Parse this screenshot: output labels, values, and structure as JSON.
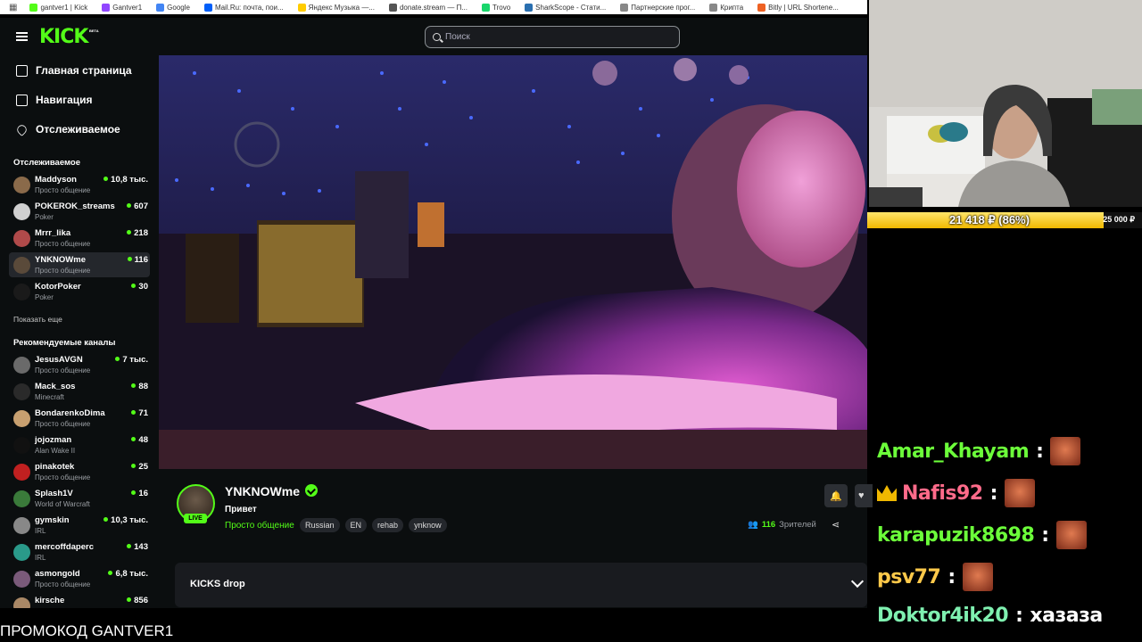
{
  "bookmarks": [
    {
      "label": "gantver1 | Kick",
      "color": "#53fc18"
    },
    {
      "label": "Gantver1",
      "color": "#9146ff"
    },
    {
      "label": "Google",
      "color": "#4285f4"
    },
    {
      "label": "Mail.Ru: почта, пои...",
      "color": "#005ff9"
    },
    {
      "label": "Яндекс Музыка —...",
      "color": "#ffcc00"
    },
    {
      "label": "donate.stream — П...",
      "color": "#555555"
    },
    {
      "label": "Trovo",
      "color": "#19d66b"
    },
    {
      "label": "SharkScope - Стати...",
      "color": "#2a6fb0"
    },
    {
      "label": "Партнерские прог...",
      "color": "#888888"
    },
    {
      "label": "Крипта",
      "color": "#888888"
    },
    {
      "label": "Bitly | URL Shortene...",
      "color": "#ee6123"
    }
  ],
  "header": {
    "logo": "KICK",
    "beta": "BETA",
    "search_placeholder": "Поиск"
  },
  "nav": [
    {
      "label": "Главная страница",
      "icon": "home-icon"
    },
    {
      "label": "Навигация",
      "icon": "browse-icon"
    },
    {
      "label": "Отслеживаемое",
      "icon": "heart-icon"
    }
  ],
  "following_title": "Отслеживаемое",
  "following": [
    {
      "name": "Maddyson",
      "category": "Просто общение",
      "viewers": "10,8 тыс.",
      "avatar": "#8a6a4a"
    },
    {
      "name": "POKEROK_streams",
      "category": "Poker",
      "viewers": "607",
      "avatar": "#d0d0d0"
    },
    {
      "name": "Mrrr_lika",
      "category": "Просто общение",
      "viewers": "218",
      "avatar": "#b04a4a"
    },
    {
      "name": "YNKNOWme",
      "category": "Просто общение",
      "viewers": "116",
      "avatar": "#5a4a3a"
    },
    {
      "name": "KotorPoker",
      "category": "Poker",
      "viewers": "30",
      "avatar": "#1a1a1a"
    }
  ],
  "show_more": "Показать еще",
  "recommended_title": "Рекомендуемые каналы",
  "recommended": [
    {
      "name": "JesusAVGN",
      "category": "Просто общение",
      "viewers": "7 тыс.",
      "avatar": "#6a6a6a"
    },
    {
      "name": "Mack_sos",
      "category": "Minecraft",
      "viewers": "88",
      "avatar": "#2a2a2a"
    },
    {
      "name": "BondarenkoDima",
      "category": "Просто общение",
      "viewers": "71",
      "avatar": "#c8a070"
    },
    {
      "name": "jojozman",
      "category": "Alan Wake II",
      "viewers": "48",
      "avatar": "#111111"
    },
    {
      "name": "pinakotek",
      "category": "Просто общение",
      "viewers": "25",
      "avatar": "#c02020"
    },
    {
      "name": "Splash1V",
      "category": "World of Warcraft",
      "viewers": "16",
      "avatar": "#3a7a3a"
    },
    {
      "name": "gymskin",
      "category": "IRL",
      "viewers": "10,3 тыс.",
      "avatar": "#888888"
    },
    {
      "name": "mercoffdaperc",
      "category": "IRL",
      "viewers": "143",
      "avatar": "#2a9a8a"
    },
    {
      "name": "asmongold",
      "category": "Просто общение",
      "viewers": "6,8 тыс.",
      "avatar": "#7a5a7a"
    },
    {
      "name": "kirsche",
      "category": "",
      "viewers": "856",
      "avatar": "#aa8866"
    }
  ],
  "stream": {
    "streamer": "YNKNOWme",
    "live": "LIVE",
    "title": "Привет",
    "category": "Просто общение",
    "tags": [
      "Russian",
      "EN",
      "rehab",
      "ynknow"
    ],
    "viewers_count": "116",
    "viewers_label": "Зрителей",
    "kicks_drop": "KICKS drop"
  },
  "donation": {
    "current": "21 418 ₽ (86%)",
    "goal": "25 000 ₽",
    "progress": 0.86
  },
  "chat": [
    {
      "user": "Amar_Khayam",
      "color": "#6cff3a",
      "emote": true,
      "crown": false,
      "text": ""
    },
    {
      "user": "Nafis92",
      "color": "#ff6b8a",
      "emote": true,
      "crown": true,
      "text": ""
    },
    {
      "user": "karapuzik8698",
      "color": "#6cff3a",
      "emote": true,
      "crown": false,
      "text": ""
    },
    {
      "user": "psv77",
      "color": "#ffc94a",
      "emote": true,
      "crown": false,
      "text": ""
    },
    {
      "user": "Doktor4ik20",
      "color": "#7ff0b0",
      "emote": false,
      "crown": false,
      "text": "хазаза"
    }
  ],
  "promo": "ПРОМОКОД GANTVER1"
}
